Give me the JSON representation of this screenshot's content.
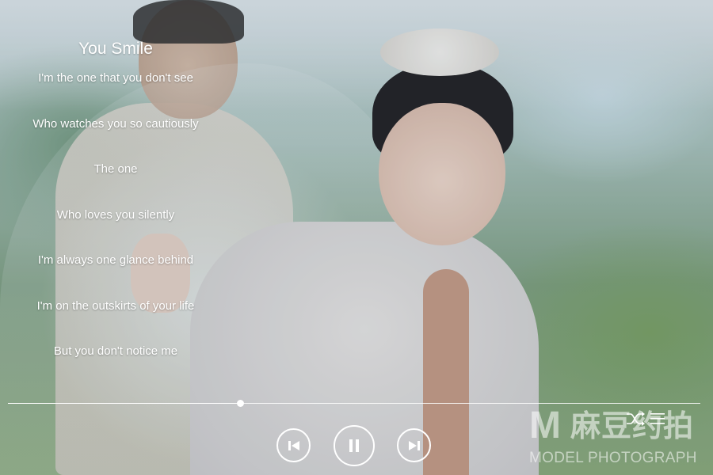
{
  "song": {
    "title": "You Smile",
    "lyrics": [
      "I'm the one that you don't see",
      "Who watches you so cautiously",
      "The one",
      "Who loves you silently",
      "I'm always one glance behind",
      "I'm on the outskirts of your life",
      "But you don't notice me"
    ]
  },
  "player": {
    "progress_fraction": 0.335,
    "controls": {
      "previous": "skip-previous-icon",
      "pause": "pause-icon",
      "next": "skip-next-icon",
      "shuffle": "shuffle-icon",
      "playlist": "playlist-icon"
    }
  },
  "watermark": {
    "mark": "M",
    "cn_text": "麻豆约拍",
    "en_text": "MODEL PHOTOGRAPH"
  },
  "colors": {
    "ui": "#ffffff"
  }
}
